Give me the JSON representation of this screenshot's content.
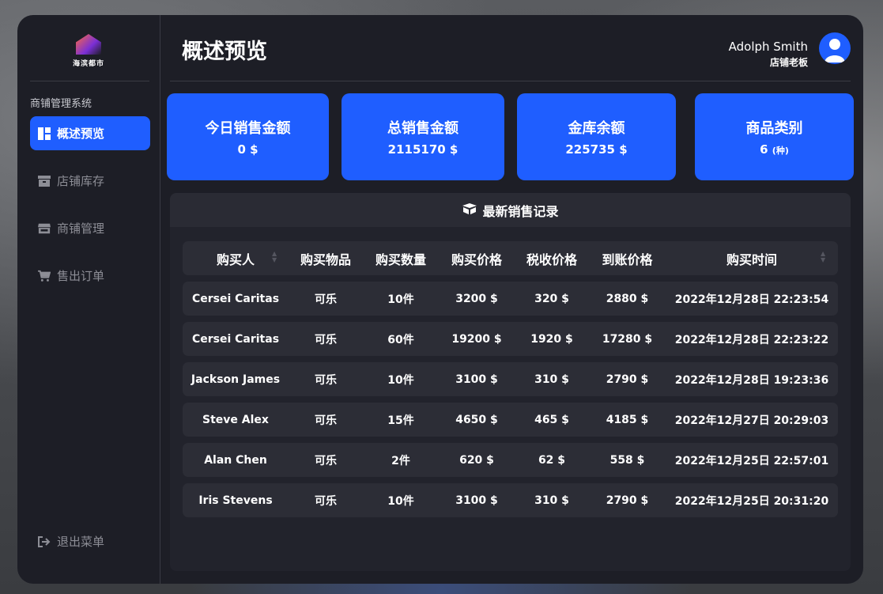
{
  "sidebar": {
    "logo_text": "海滨都市",
    "caption": "商铺管理系统",
    "items": [
      {
        "label": "概述预览"
      },
      {
        "label": "店铺库存"
      },
      {
        "label": "商铺管理"
      },
      {
        "label": "售出订单"
      }
    ],
    "logout_label": "退出菜单"
  },
  "header": {
    "title": "概述预览",
    "user_name": "Adolph Smith",
    "user_role": "店铺老板"
  },
  "stats": [
    {
      "label": "今日销售金额",
      "value": "0 $"
    },
    {
      "label": "总销售金额",
      "value": "2115170 $"
    },
    {
      "label": "金库余额",
      "value": "225735 $"
    },
    {
      "label": "商品类别",
      "value": "6",
      "unit": "(种)"
    }
  ],
  "records": {
    "title": "最新销售记录",
    "columns": [
      "购买人",
      "购买物品",
      "购买数量",
      "购买价格",
      "税收价格",
      "到账价格",
      "购买时间"
    ],
    "rows": [
      [
        "Cersei Caritas",
        "可乐",
        "10件",
        "3200 $",
        "320 $",
        "2880 $",
        "2022年12月28日 22:23:54"
      ],
      [
        "Cersei Caritas",
        "可乐",
        "60件",
        "19200 $",
        "1920 $",
        "17280 $",
        "2022年12月28日 22:23:22"
      ],
      [
        "Jackson James",
        "可乐",
        "10件",
        "3100 $",
        "310 $",
        "2790 $",
        "2022年12月28日 19:23:36"
      ],
      [
        "Steve Alex",
        "可乐",
        "15件",
        "4650 $",
        "465 $",
        "4185 $",
        "2022年12月27日 20:29:03"
      ],
      [
        "Alan Chen",
        "可乐",
        "2件",
        "620 $",
        "62 $",
        "558 $",
        "2022年12月25日 22:57:01"
      ],
      [
        "Iris Stevens",
        "可乐",
        "10件",
        "3100 $",
        "310 $",
        "2790 $",
        "2022年12月25日 20:31:20"
      ]
    ]
  },
  "colors": {
    "accent": "#1f5eff",
    "panel": "#1d1e26",
    "row": "#2c2d36"
  }
}
